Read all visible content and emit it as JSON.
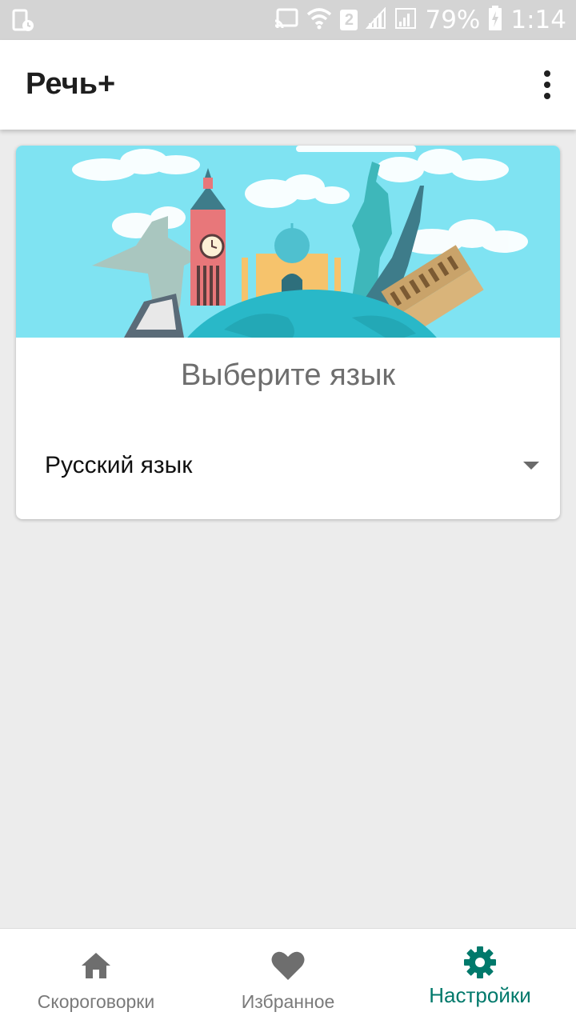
{
  "status_bar": {
    "battery": "79%",
    "time": "1:14",
    "sim_slot": "2",
    "icons": [
      "screenshot-icon",
      "cast-icon",
      "wifi-icon",
      "signal-icon",
      "battery-charging-icon"
    ]
  },
  "app_bar": {
    "title": "Речь+",
    "menu_icon": "more-vert-icon"
  },
  "card": {
    "banner_image": "world-landmarks-illustration",
    "heading": "Выберите язык",
    "language_select": {
      "selected": "Русский язык"
    }
  },
  "bottom_nav": {
    "items": [
      {
        "label": "Скороговорки",
        "icon": "home-icon",
        "active": false
      },
      {
        "label": "Избранное",
        "icon": "heart-icon",
        "active": false
      },
      {
        "label": "Настройки",
        "icon": "gear-icon",
        "active": true
      }
    ]
  },
  "colors": {
    "accent": "#00796b",
    "inactive": "#6e6e6e",
    "sky": "#7fe3f2",
    "background": "#ececec"
  }
}
